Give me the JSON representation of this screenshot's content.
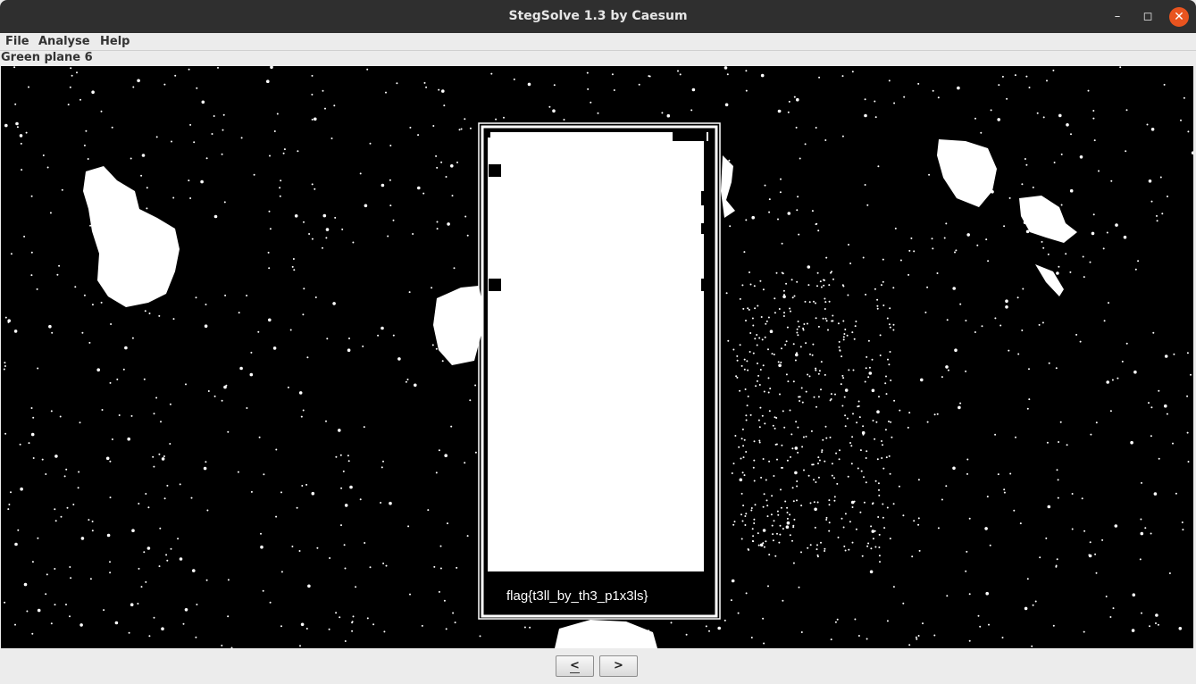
{
  "window": {
    "title": "StegSolve 1.3 by Caesum"
  },
  "menu": {
    "items": [
      "File",
      "Analyse",
      "Help"
    ]
  },
  "status": {
    "plane_label": "Green plane 6"
  },
  "image": {
    "flag_text": "flag{t3ll_by_th3_p1x3ls}"
  },
  "nav": {
    "prev_label": "<",
    "next_label": ">"
  },
  "colors": {
    "titlebar": "#2f2f2f",
    "close_button": "#e9541f",
    "canvas_bg": "#000000",
    "foreground": "#ffffff"
  }
}
